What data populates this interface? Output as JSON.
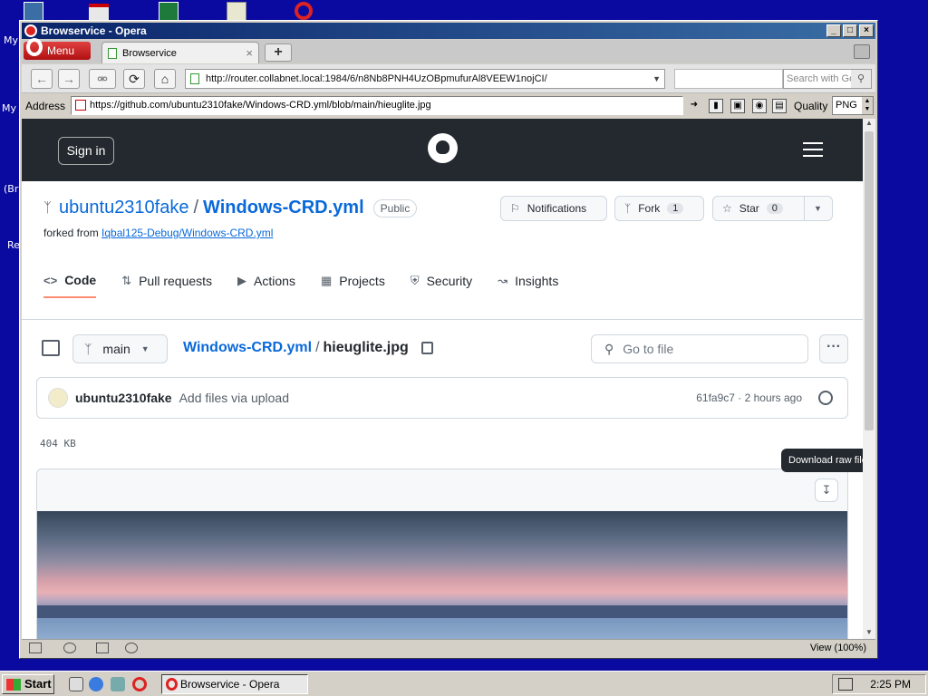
{
  "window": {
    "title": "Browservice - Opera",
    "buttons": [
      "_",
      "□",
      "×"
    ]
  },
  "browser": {
    "menu_label": "Menu",
    "tab_label": "Browservice",
    "tab_close": "×",
    "new_tab": "+",
    "url": "http://router.collabnet.local:1984/6/n8Nb8PNH4UzOBpmufurAl8VEEW1nojCI/",
    "search_placeholder": "Search with Google",
    "search_icon": "magnifier-icon",
    "address_label": "Address",
    "address_value": "https://github.com/ubuntu2310fake/Windows-CRD.yml/blob/main/hieuglite.jpg",
    "quality_label": "Quality",
    "quality_value": "PNG",
    "zoom_label": "View (100%)"
  },
  "github": {
    "signin": "Sign in",
    "owner": "ubuntu2310fake",
    "slash": "/",
    "repo": "Windows-CRD.yml",
    "visibility": "Public",
    "forked_prefix": "forked from",
    "forked_link": "Iqbal125-Debug/Windows-CRD.yml",
    "notifications": "Notifications",
    "fork": "Fork",
    "fork_count": "1",
    "star": "Star",
    "star_count": "0",
    "nav": {
      "code": "Code",
      "pulls": "Pull requests",
      "actions": "Actions",
      "projects": "Projects",
      "security": "Security",
      "insights": "Insights"
    },
    "branch": "main",
    "breadcrumb_repo": "Windows-CRD.yml",
    "breadcrumb_file": "hieuglite.jpg",
    "goto_file": "Go to file",
    "commit": {
      "author": "ubuntu2310fake",
      "message": "Add files via upload",
      "meta": "61fa9c7 · 2 hours ago"
    },
    "file_size": "404 KB",
    "tooltip": "Download raw file"
  },
  "taskbar": {
    "start": "Start",
    "task": "Browservice - Opera",
    "clock": "2:25 PM"
  },
  "desktop_labels": [
    "My",
    "My",
    "(Br",
    "Re"
  ]
}
